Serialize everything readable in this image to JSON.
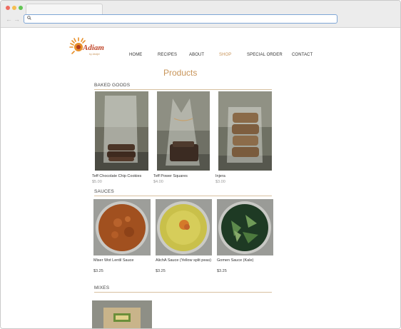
{
  "site": {
    "logo_text": "Adiam",
    "logo_tagline": "by Abdjel"
  },
  "nav": {
    "items": [
      {
        "label": "HOME"
      },
      {
        "label": "RECIPES"
      },
      {
        "label": "ABOUT"
      },
      {
        "label": "SHOP",
        "active": true
      },
      {
        "label": "SPECIAL ORDER"
      },
      {
        "label": "CONTACT"
      }
    ]
  },
  "page": {
    "title": "Products"
  },
  "sections": [
    {
      "heading": "BAKED GOODS",
      "products": [
        {
          "name": "Teff Chocolate Chip Cookies",
          "price": "$5.00"
        },
        {
          "name": "Teff Power Squares",
          "price": "$4.00"
        },
        {
          "name": "Injera",
          "price": "$3.00"
        }
      ]
    },
    {
      "heading": "SAUCES",
      "products": [
        {
          "name": "Miser Wot Lentil Sauce",
          "price": "$3.25"
        },
        {
          "name": "AlichA Sauce (Yellow split peas)",
          "price": "$3.25"
        },
        {
          "name": "Gomen Sauce (Kale)",
          "price": "$3.25"
        }
      ]
    },
    {
      "heading": "MIXES",
      "products": []
    }
  ],
  "colors": {
    "accent": "#c8955a",
    "rule": "#d8c0a0"
  }
}
